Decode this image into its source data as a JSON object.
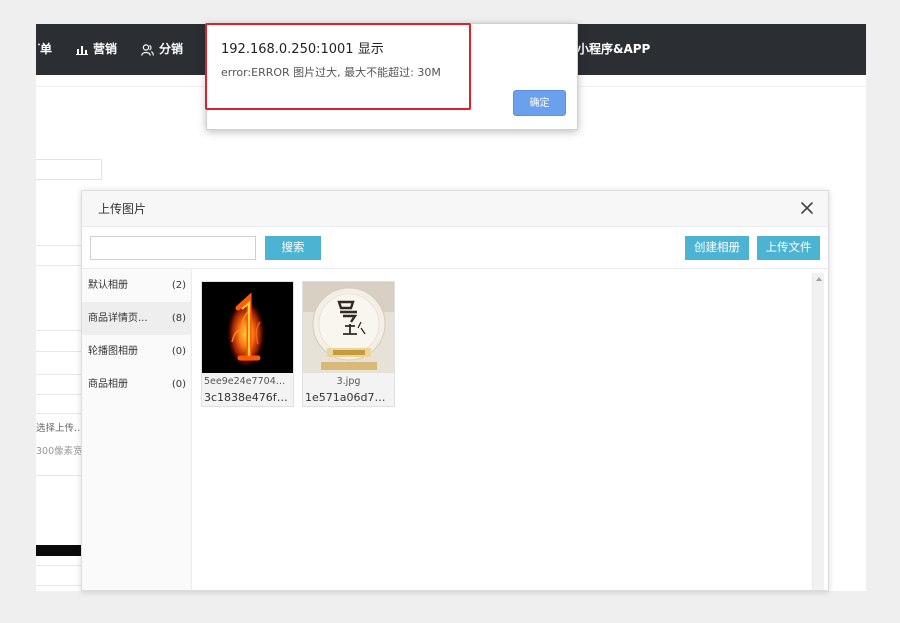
{
  "topnav": {
    "items": [
      {
        "label": "订单",
        "icon": "list-icon"
      },
      {
        "label": "营销",
        "icon": "bar-chart-icon"
      },
      {
        "label": "分销",
        "icon": "users-icon"
      },
      {
        "label": "小程序&APP",
        "icon": ""
      }
    ]
  },
  "background": {
    "texts": [
      "选择上传…",
      "300像素宽…"
    ]
  },
  "upload_dialog": {
    "title": "上传图片",
    "search_placeholder": "",
    "search_button": "搜索",
    "create_album_button": "创建相册",
    "upload_file_button": "上传文件",
    "albums": [
      {
        "name": "默认相册",
        "count": "(2)"
      },
      {
        "name": "商品详情页...",
        "count": "(8)"
      },
      {
        "name": "轮播图相册",
        "count": "(0)"
      },
      {
        "name": "商品相册",
        "count": "(0)"
      }
    ],
    "images": [
      {
        "name": "5ee9e24e7704b9...",
        "id": "3c1838e476f2..."
      },
      {
        "name": "3.jpg",
        "id": "1e571a06d7b3..."
      }
    ]
  },
  "alert": {
    "title": "192.168.0.250:1001 显示",
    "message": "error:ERROR 图片过大, 最大不能超过: 30M",
    "ok_button": "确定"
  },
  "colors": {
    "nav_bg": "#2b2e33",
    "button_blue": "#4cb4d2",
    "alert_button": "#6aa0ec",
    "highlight_red": "#e0202a"
  }
}
